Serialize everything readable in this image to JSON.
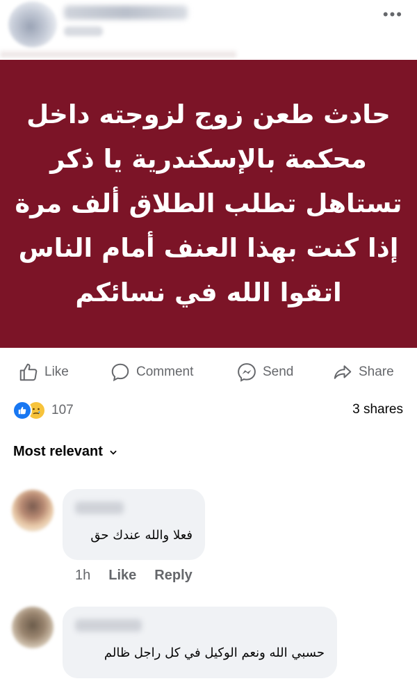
{
  "post": {
    "more_icon": "ellipsis-icon",
    "banner_lines": [
      "حادث طعن زوج لزوجته داخل",
      "محكمة بالإسكندرية يا ذكر",
      "تستاهل تطلب الطلاق ألف مرة",
      "إذا كنت بهذا العنف أمام الناس",
      "اتقوا الله في نسائكم"
    ],
    "banner_color": "#7c1427"
  },
  "actions": {
    "like": "Like",
    "comment": "Comment",
    "send": "Send",
    "share": "Share"
  },
  "stats": {
    "reaction_count": "107",
    "shares": "3 shares"
  },
  "sort": {
    "label": "Most relevant"
  },
  "comments": [
    {
      "text": "فعلا والله عندك حق",
      "time": "1h",
      "like": "Like",
      "reply": "Reply"
    },
    {
      "text": "حسبي الله ونعم الوكيل في كل راجل ظالم"
    }
  ]
}
